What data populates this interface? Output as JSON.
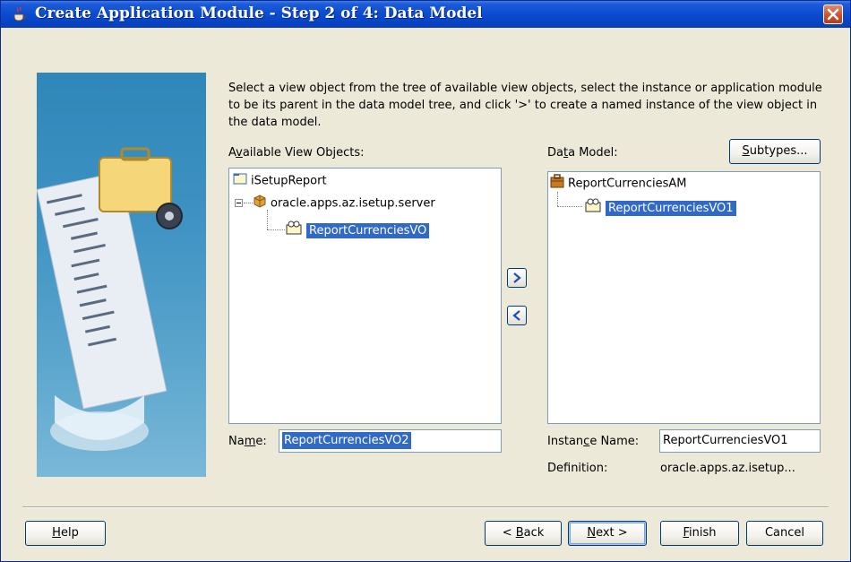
{
  "window": {
    "title": "Create Application Module - Step 2 of 4: Data Model"
  },
  "instructions": "Select a view object from the tree of available view objects, select the instance or application module to be its parent in the data model tree, and click '>' to create a named instance of the view object in the data model.",
  "available": {
    "label_pre": "A",
    "label_u": "v",
    "label_post": "ailable View Objects:",
    "tree": {
      "root": "iSetupReport",
      "package": "oracle.apps.az.isetup.server",
      "view_object": "ReportCurrenciesVO"
    }
  },
  "data_model": {
    "label_pre": "Da",
    "label_u": "t",
    "label_post": "a Model:",
    "subtypes_u": "S",
    "subtypes_post": "ubtypes...",
    "tree": {
      "root": "ReportCurrenciesAM",
      "instance": "ReportCurrenciesVO1"
    }
  },
  "name_field": {
    "label_pre": "Na",
    "label_u": "m",
    "label_post": "e:",
    "value": "ReportCurrenciesVO2"
  },
  "instance_name": {
    "label_pre": "Instan",
    "label_u": "c",
    "label_post": "e Name:",
    "value": "ReportCurrenciesVO1"
  },
  "definition": {
    "label": "Definition:",
    "value": "oracle.apps.az.isetup..."
  },
  "buttons": {
    "help_u": "H",
    "help_post": "elp",
    "back_pre": "< ",
    "back_u": "B",
    "back_post": "ack",
    "next_u": "N",
    "next_post": "ext >",
    "finish_u": "F",
    "finish_post": "inish",
    "cancel": "Cancel"
  },
  "colors": {
    "selection": "#3169c6",
    "titlebar": "#0a4cd0",
    "dialog_bg": "#ece9d8"
  }
}
